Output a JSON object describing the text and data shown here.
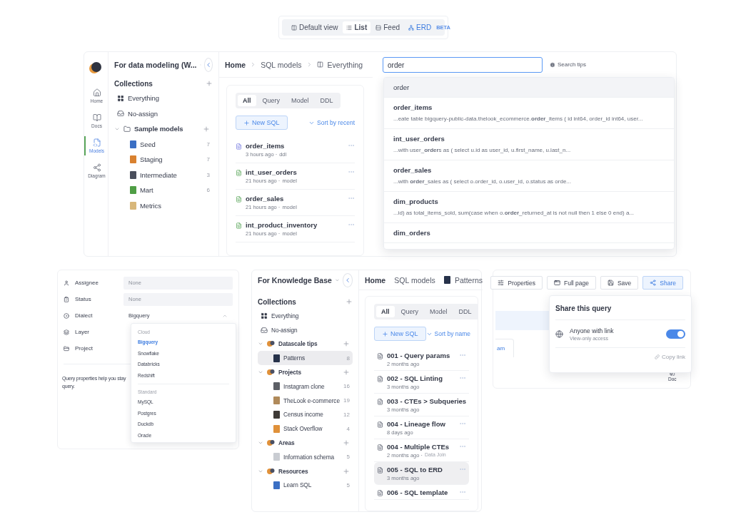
{
  "view_switcher": {
    "options": [
      {
        "label": "Default view",
        "kind": "columns",
        "selected": false
      },
      {
        "label": "List",
        "kind": "list",
        "selected": true
      },
      {
        "label": "Feed",
        "kind": "feed",
        "selected": false
      },
      {
        "label": "ERD",
        "kind": "erd",
        "selected": false,
        "badge": "BETA"
      }
    ]
  },
  "models_window": {
    "rail": [
      {
        "label": "Home",
        "kind": "home",
        "selected": false
      },
      {
        "label": "Docs",
        "kind": "docs",
        "selected": false
      },
      {
        "label": "Models",
        "kind": "models",
        "selected": true
      },
      {
        "label": "Diagram",
        "kind": "diagram",
        "selected": false
      }
    ],
    "workspace": "For data modeling (W...",
    "collections_title": "Collections",
    "collections": [
      {
        "label": "Everything",
        "kind": "all",
        "selected": false
      },
      {
        "label": "No-assign",
        "kind": "inbox",
        "selected": false
      },
      {
        "label": "Sample models",
        "kind": "folder",
        "selected": false,
        "expanded": true,
        "children": [
          {
            "label": "Seed",
            "count": "7",
            "color": "#3b6fc4",
            "selected": false
          },
          {
            "label": "Staging",
            "count": "7",
            "color": "#d9812f",
            "selected": false
          },
          {
            "label": "Intermediate",
            "count": "3",
            "color": "#4a4f5c",
            "selected": false
          },
          {
            "label": "Mart",
            "count": "6",
            "color": "#4f9e45",
            "selected": false
          },
          {
            "label": "Metrics",
            "color": "#d8b77a",
            "selected": false
          }
        ]
      }
    ],
    "breadcrumb": [
      "Home",
      "SQL models",
      "Everything"
    ],
    "filter_tabs": [
      {
        "label": "All",
        "selected": true
      },
      {
        "label": "Query",
        "selected": false
      },
      {
        "label": "Model",
        "selected": false
      },
      {
        "label": "DDL",
        "selected": false
      }
    ],
    "new_button": "New SQL",
    "sort": "Sort by recent",
    "files": [
      {
        "name": "order_items",
        "meta": "3 hours ago ·",
        "type": "ddl",
        "selected": false
      },
      {
        "name": "int_user_orders",
        "meta": "21 hours ago ·",
        "type": "model",
        "selected": false
      },
      {
        "name": "order_sales",
        "meta": "21 hours ago ·",
        "type": "model",
        "selected": false
      },
      {
        "name": "int_product_inventory",
        "meta": "21 hours ago ·",
        "type": "model",
        "selected": false
      }
    ],
    "search": {
      "value": "order",
      "tips": "Search tips",
      "suggestions": [
        {
          "title": "order",
          "selected": true
        },
        {
          "title": "order_items",
          "snippet": "...eate table bigquery-public-data.thelook_ecommerce.**order**_items ( id int64, order_id int64, user...",
          "selected": false
        },
        {
          "title": "int_user_orders",
          "snippet": "...with user_**order**s as ( select u.id as user_id, u.first_name, u.last_n...",
          "selected": false
        },
        {
          "title": "order_sales",
          "snippet": "...with **order**_sales as ( select o.order_id, o.user_id, o.status as orde...",
          "selected": false
        },
        {
          "title": "dim_products",
          "snippet": "...id) as total_items_sold, sum(case when o.**order**_returned_at is not null then 1 else 0 end) a...",
          "selected": false
        },
        {
          "title": "dim_orders",
          "selected": false
        }
      ]
    }
  },
  "properties_panel": {
    "fields": [
      {
        "label": "Assignee",
        "kind": "user",
        "placeholder": "None"
      },
      {
        "label": "Status",
        "kind": "status",
        "placeholder": "None"
      },
      {
        "label": "Dialect",
        "kind": "dialect",
        "value": "Bigquery",
        "expanded": true
      },
      {
        "label": "Layer",
        "kind": "layer"
      },
      {
        "label": "Project",
        "kind": "project"
      }
    ],
    "note": [
      "Query properties help you stay",
      "query."
    ],
    "dialect_menu": [
      {
        "label": "Cloud",
        "options": [
          {
            "label": "Bigquery",
            "selected": true
          },
          {
            "label": "Snowflake",
            "selected": false
          },
          {
            "label": "Databricks",
            "selected": false
          },
          {
            "label": "Redshift",
            "selected": false
          }
        ]
      },
      {
        "label": "Standard",
        "options": [
          {
            "label": "MySQL",
            "selected": false
          },
          {
            "label": "Postgres",
            "selected": false
          },
          {
            "label": "Duckdb",
            "selected": false
          },
          {
            "label": "Oracle",
            "selected": false
          }
        ]
      }
    ]
  },
  "knowledge_window": {
    "workspace": "For Knowledge Base",
    "collections_title": "Collections",
    "collections": [
      {
        "label": "Everything",
        "kind": "all",
        "selected": false
      },
      {
        "label": "No-assign",
        "kind": "inbox",
        "selected": false
      },
      {
        "label": "Datascale tips",
        "kind": "group",
        "selected": false,
        "expanded": true,
        "children": [
          {
            "label": "Patterns",
            "count": "8",
            "color": "#27324a",
            "selected": true
          }
        ]
      },
      {
        "label": "Projects",
        "kind": "group",
        "selected": false,
        "expanded": true,
        "children": [
          {
            "label": "Instagram clone",
            "count": "16",
            "color": "#5c5f66",
            "selected": false
          },
          {
            "label": "TheLook e-commerce",
            "count": "19",
            "color": "#b08a5a",
            "selected": false
          },
          {
            "label": "Census income",
            "count": "12",
            "color": "#3e3a36",
            "selected": false
          },
          {
            "label": "Stack Overflow",
            "count": "4",
            "color": "#e0913a",
            "selected": false
          }
        ]
      },
      {
        "label": "Areas",
        "kind": "group",
        "selected": false,
        "expanded": true,
        "children": [
          {
            "label": "Information schema",
            "count": "5",
            "color": "#c9ccd2",
            "selected": false
          }
        ]
      },
      {
        "label": "Resources",
        "kind": "group",
        "selected": false,
        "expanded": true,
        "children": [
          {
            "label": "Learn SQL",
            "count": "5",
            "color": "#3b6fc4",
            "selected": false
          }
        ]
      }
    ],
    "breadcrumb": [
      "Home",
      "SQL models",
      "Patterns"
    ],
    "filter_tabs": [
      {
        "label": "All",
        "selected": true
      },
      {
        "label": "Query",
        "selected": false
      },
      {
        "label": "Model",
        "selected": false
      },
      {
        "label": "DDL",
        "selected": false
      }
    ],
    "new_button": "New SQL",
    "sort": "Sort by name",
    "files": [
      {
        "name": "001 - Query params",
        "meta": "2 months ago",
        "selected": false
      },
      {
        "name": "002 - SQL Linting",
        "meta": "3 months ago",
        "selected": false
      },
      {
        "name": "003 - CTEs > Subqueries",
        "meta": "3 months ago",
        "selected": false
      },
      {
        "name": "004 - Lineage flow",
        "meta": "8 days ago",
        "selected": false
      },
      {
        "name": "004 - Multiple CTEs",
        "meta": "2 months ago ·",
        "type": "Data Join",
        "selected": false
      },
      {
        "name": "005 - SQL to ERD",
        "meta": "3 months ago",
        "selected": true
      },
      {
        "name": "006 - SQL template",
        "selected": false
      }
    ]
  },
  "editor_panel": {
    "actions": [
      {
        "label": "Properties",
        "kind": "properties",
        "selected": false
      },
      {
        "label": "Full page",
        "kind": "fullpage",
        "selected": false
      },
      {
        "label": "Save",
        "kind": "save",
        "selected": false
      },
      {
        "label": "Share",
        "kind": "share",
        "selected": true
      }
    ],
    "tab_fragment": "am",
    "side_label": "Doc",
    "share_popover": {
      "title": "Share this query",
      "option": "Anyone with link",
      "hint": "View-only access",
      "on": true,
      "copy": "Copy link"
    }
  }
}
